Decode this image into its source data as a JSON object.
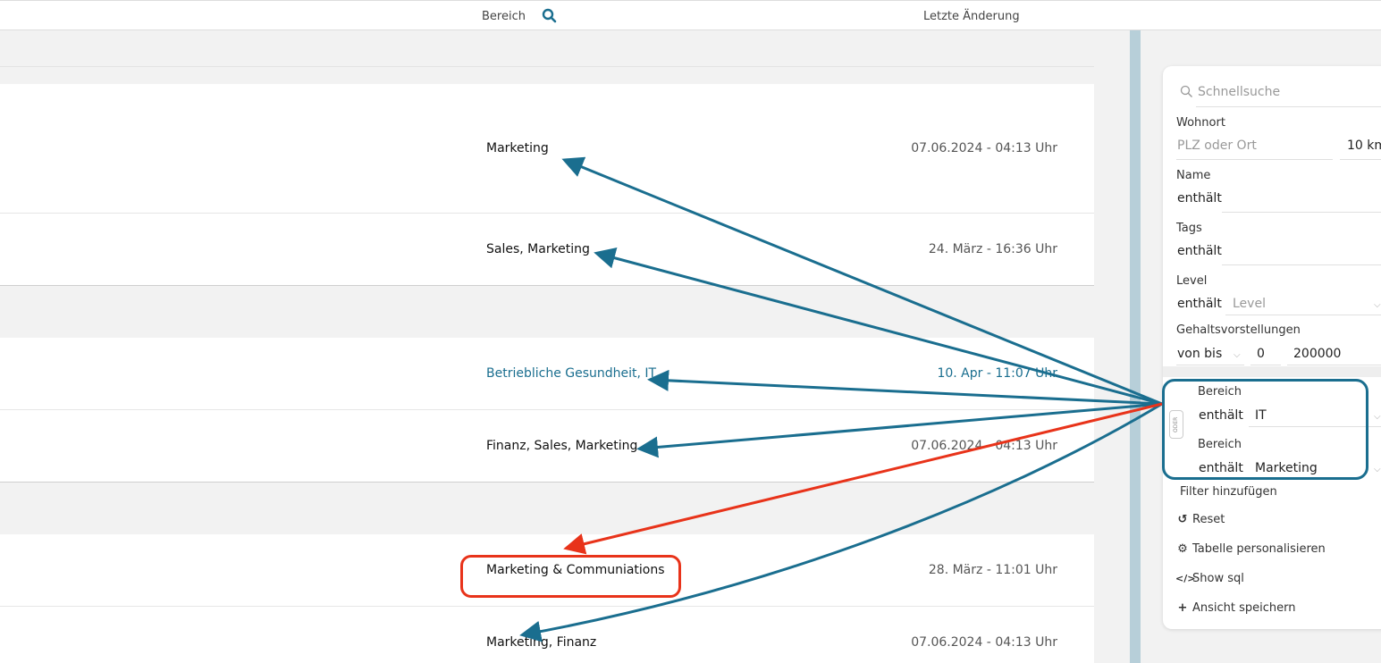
{
  "header": {
    "col_bereich": "Bereich",
    "col_letzte_aenderung": "Letzte Änderung"
  },
  "rows": [
    {
      "bereich": "Marketing",
      "date": "07.06.2024 - 04:13 Uhr"
    },
    {
      "bereich": "Sales, Marketing",
      "date": "24. März - 16:36 Uhr"
    },
    {
      "bereich": "Betriebliche Gesundheit, IT",
      "date": "10. Apr - 11:07 Uhr"
    },
    {
      "bereich": "Finanz, Sales, Marketing",
      "date": "07.06.2024 - 04:13 Uhr"
    },
    {
      "bereich": "Marketing & Communiations",
      "date": "28. März - 11:01 Uhr"
    },
    {
      "bereich": "Marketing, Finanz",
      "date": "07.06.2024 - 04:13 Uhr"
    }
  ],
  "panel": {
    "quicksearch_placeholder": "Schnellsuche",
    "wohnort": {
      "label": "Wohnort",
      "placeholder": "PLZ oder Ort",
      "radius": "10 km"
    },
    "name": {
      "label": "Name",
      "operator": "enthält"
    },
    "tags": {
      "label": "Tags",
      "operator": "enthält"
    },
    "level": {
      "label": "Level",
      "operator": "enthält",
      "placeholder": "Level"
    },
    "gehalt": {
      "label": "Gehaltsvorstellungen",
      "operator": "von bis",
      "from": "0",
      "to": "200000"
    },
    "oder_label": "ODER",
    "bereich_filters": [
      {
        "label": "Bereich",
        "operator": "enthält",
        "value": "IT"
      },
      {
        "label": "Bereich",
        "operator": "enthält",
        "value": "Marketing"
      }
    ],
    "add_filter": "Filter hinzufügen",
    "actions": {
      "reset": "Reset",
      "customize": "Tabelle personalisieren",
      "show_sql": "Show sql",
      "save_view": "Ansicht speichern"
    }
  },
  "colors": {
    "accent": "#1a6e8f",
    "highlight_red": "#e8331a",
    "row_highlight_text": "#1a6e8f"
  }
}
